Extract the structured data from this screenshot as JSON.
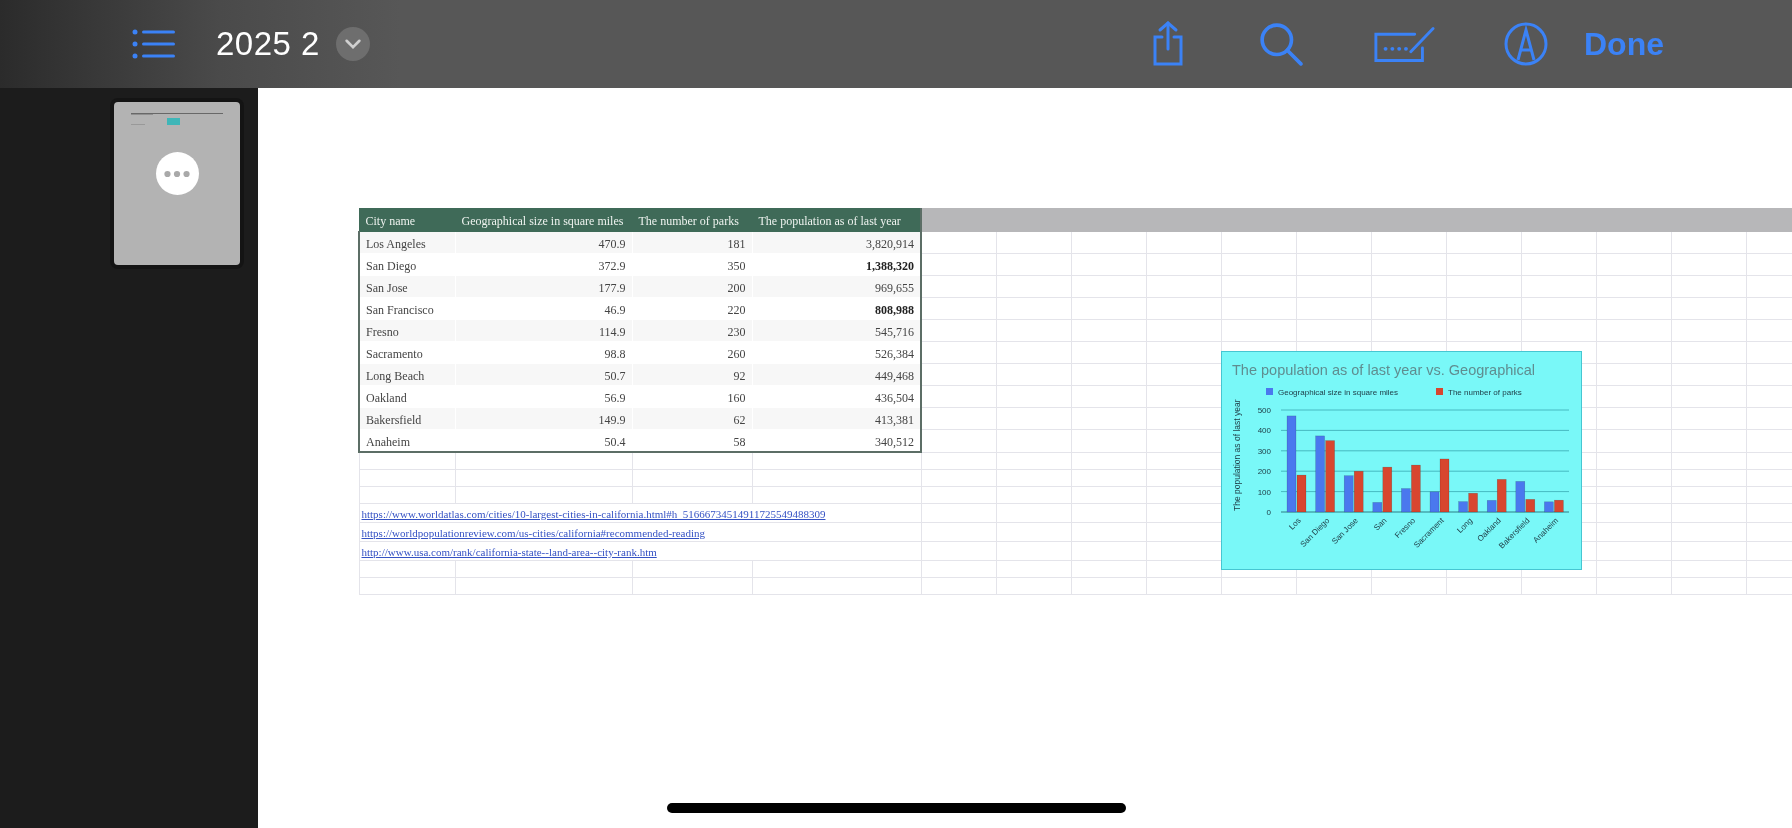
{
  "toolbar": {
    "title": "2025 2",
    "done_label": "Done"
  },
  "table": {
    "columns": [
      "City name",
      "Geographical size in square miles",
      "The number of parks",
      "The population as of last year"
    ],
    "rows": [
      {
        "city": "Los Angeles",
        "size": "470.9",
        "parks": "181",
        "population": "3,820,914",
        "emphasized": false
      },
      {
        "city": "San Diego",
        "size": "372.9",
        "parks": "350",
        "population": "1,388,320",
        "emphasized": true
      },
      {
        "city": "San Jose",
        "size": "177.9",
        "parks": "200",
        "population": "969,655",
        "emphasized": false
      },
      {
        "city": "San Francisco",
        "size": "46.9",
        "parks": "220",
        "population": "808,988",
        "emphasized": true
      },
      {
        "city": "Fresno",
        "size": "114.9",
        "parks": "230",
        "population": "545,716",
        "emphasized": false
      },
      {
        "city": "Sacramento",
        "size": "98.8",
        "parks": "260",
        "population": "526,384",
        "emphasized": false
      },
      {
        "city": "Long Beach",
        "size": "50.7",
        "parks": "92",
        "population": "449,468",
        "emphasized": false
      },
      {
        "city": "Oakland",
        "size": "56.9",
        "parks": "160",
        "population": "436,504",
        "emphasized": false
      },
      {
        "city": "Bakersfield",
        "size": "149.9",
        "parks": "62",
        "population": "413,381",
        "emphasized": false
      },
      {
        "city": "Anaheim",
        "size": "50.4",
        "parks": "58",
        "population": "340,512",
        "emphasized": false
      }
    ]
  },
  "links": [
    "https://www.worldatlas.com/cities/10-largest-cities-in-california.html#h_51666734514911725549488309",
    "https://worldpopulationreview.com/us-cities/california#recommended-reading",
    "http://www.usa.com/rank/california-state--land-area--city-rank.htm"
  ],
  "chart": {
    "chart_data": {
      "type": "bar",
      "title": "The population as of last year vs. Geographical",
      "ylabel": "The population as of last year",
      "categories": [
        "Los",
        "San Diego",
        "San Jose",
        "San",
        "Fresno",
        "Sacrament",
        "Long",
        "Oakland",
        "Bakersfield",
        "Anaheim"
      ],
      "series": [
        {
          "name": "Geographical size in square miles",
          "color": "#4a78ee",
          "values": [
            471,
            373,
            178,
            47,
            115,
            99,
            51,
            57,
            150,
            50
          ]
        },
        {
          "name": "The number of parks",
          "color": "#d8462f",
          "values": [
            181,
            350,
            200,
            220,
            230,
            260,
            92,
            160,
            62,
            58
          ]
        }
      ],
      "ylim": [
        0,
        500
      ],
      "yticks": [
        0,
        100,
        200,
        300,
        400,
        500
      ],
      "grid": true,
      "legend": "top"
    }
  }
}
